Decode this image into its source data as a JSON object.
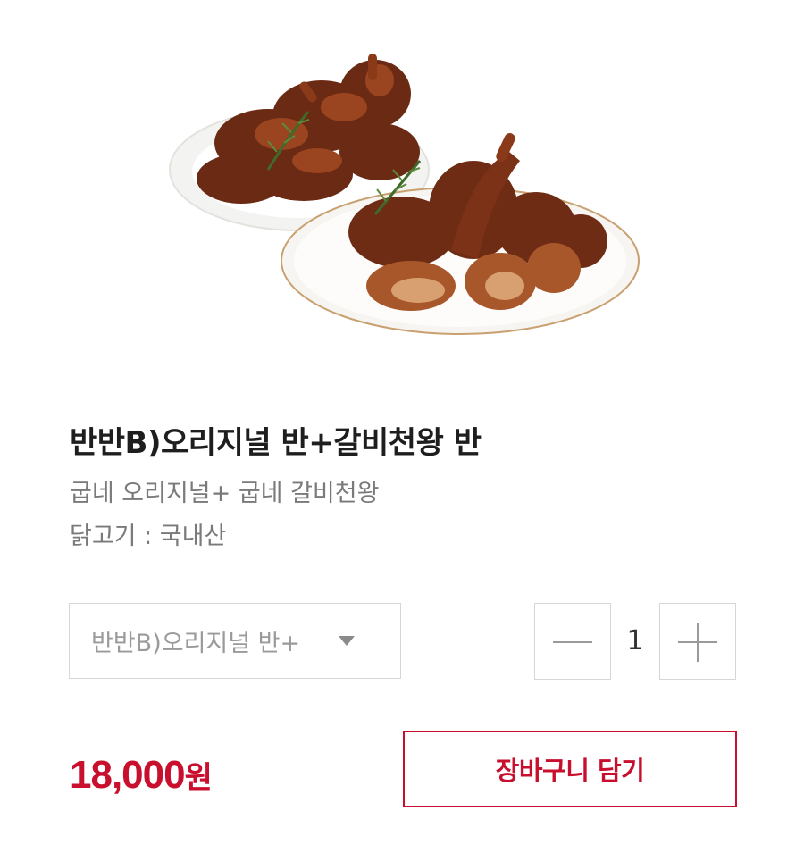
{
  "product": {
    "image_alt": "chicken-platter",
    "title": "반반B)오리지널 반+갈비천왕 반",
    "description": "굽네 오리지널+ 굽네 갈비천왕",
    "origin": "닭고기 : 국내산"
  },
  "option_select": {
    "selected": "반반B)오리지널 반+"
  },
  "quantity": {
    "value": "1",
    "minus_icon": "minus-icon",
    "plus_icon": "plus-icon"
  },
  "price": {
    "amount": "18,000",
    "unit": "원"
  },
  "cart_button": {
    "label": "장바구니 담기"
  },
  "colors": {
    "accent": "#c8102e",
    "border": "#d6d6d6",
    "muted_text": "#7a7a7a"
  }
}
